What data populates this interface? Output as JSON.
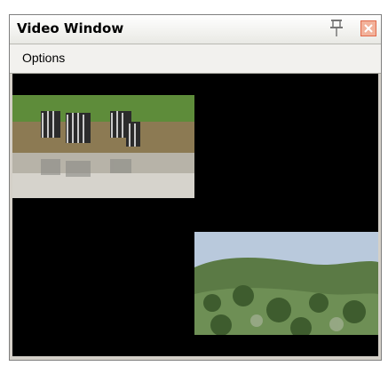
{
  "window": {
    "title": "Video Window",
    "pin_icon": "pin-icon",
    "close_icon": "close-icon"
  },
  "menu": {
    "items": [
      {
        "label": "Options"
      }
    ]
  },
  "videos": [
    {
      "name": "zebra-video-thumbnail"
    },
    {
      "name": "landscape-video-thumbnail"
    }
  ],
  "colors": {
    "video_background": "#000000",
    "close_bg": "#f2b29b"
  }
}
